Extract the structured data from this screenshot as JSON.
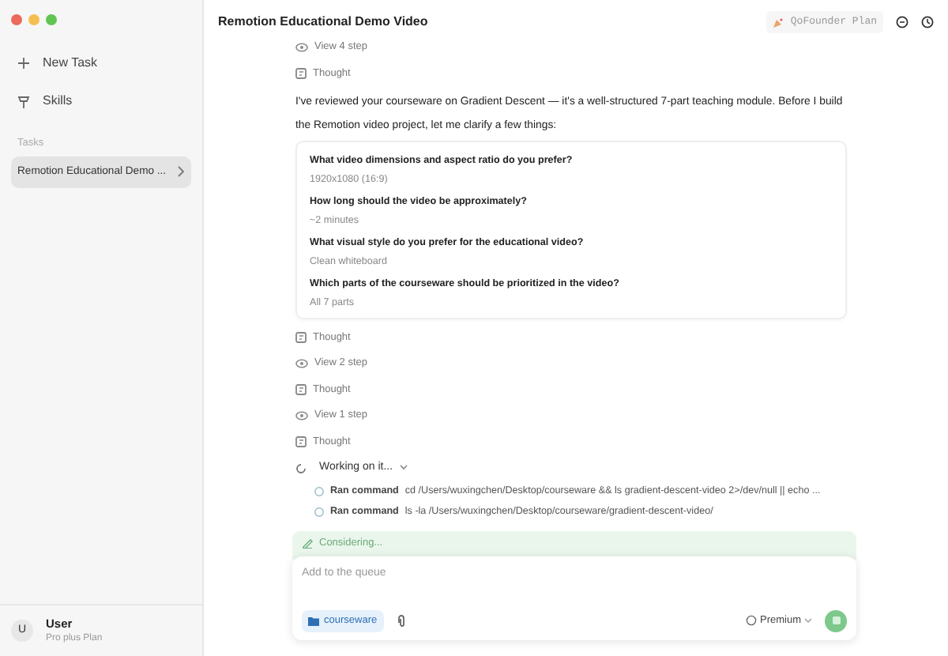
{
  "sidebar": {
    "new_task": "New Task",
    "skills": "Skills",
    "section": "Tasks",
    "tasks": [
      {
        "label": "Remotion Educational Demo ...",
        "selected": true
      }
    ],
    "user": {
      "initial": "U",
      "name": "User",
      "plan": "Pro plus Plan"
    }
  },
  "header": {
    "title": "Remotion Educational Demo Video",
    "plan_badge": "QoFounder Plan"
  },
  "feed": [
    {
      "kind": "view",
      "text": "View 4 step"
    },
    {
      "kind": "thought",
      "text": "Thought"
    },
    {
      "kind": "text",
      "text": "I've reviewed your courseware on Gradient Descent — it's a well-structured 7-part teaching module. Before I build the Remotion video project, let me clarify a few things:"
    },
    {
      "kind": "qa",
      "items": [
        {
          "question": "What video dimensions and aspect ratio do you prefer?",
          "answer": "1920x1080 (16:9)"
        },
        {
          "question": "How long should the video be approximately?",
          "answer": "~2 minutes"
        },
        {
          "question": "What visual style do you prefer for the educational video?",
          "answer": "Clean whiteboard"
        },
        {
          "question": "Which parts of the courseware should be prioritized in the video?",
          "answer": "All 7 parts"
        }
      ]
    },
    {
      "kind": "thought",
      "text": "Thought"
    },
    {
      "kind": "view",
      "text": "View 2 step"
    },
    {
      "kind": "thought",
      "text": "Thought"
    },
    {
      "kind": "view",
      "text": "View 1 step"
    },
    {
      "kind": "thought",
      "text": "Thought"
    },
    {
      "kind": "working",
      "label": "Working on it...",
      "expanded": true,
      "commands": [
        {
          "label": "Ran command",
          "command": "cd /Users/wuxingchen/Desktop/courseware && ls gradient-descent-video 2>/dev/null || echo ..."
        },
        {
          "label": "Ran command",
          "command": "ls -la /Users/wuxingchen/Desktop/courseware/gradient-descent-video/"
        }
      ]
    }
  ],
  "composer": {
    "status": "Considering...",
    "placeholder": "Add to the queue",
    "folder": "courseware",
    "model": "Premium"
  }
}
